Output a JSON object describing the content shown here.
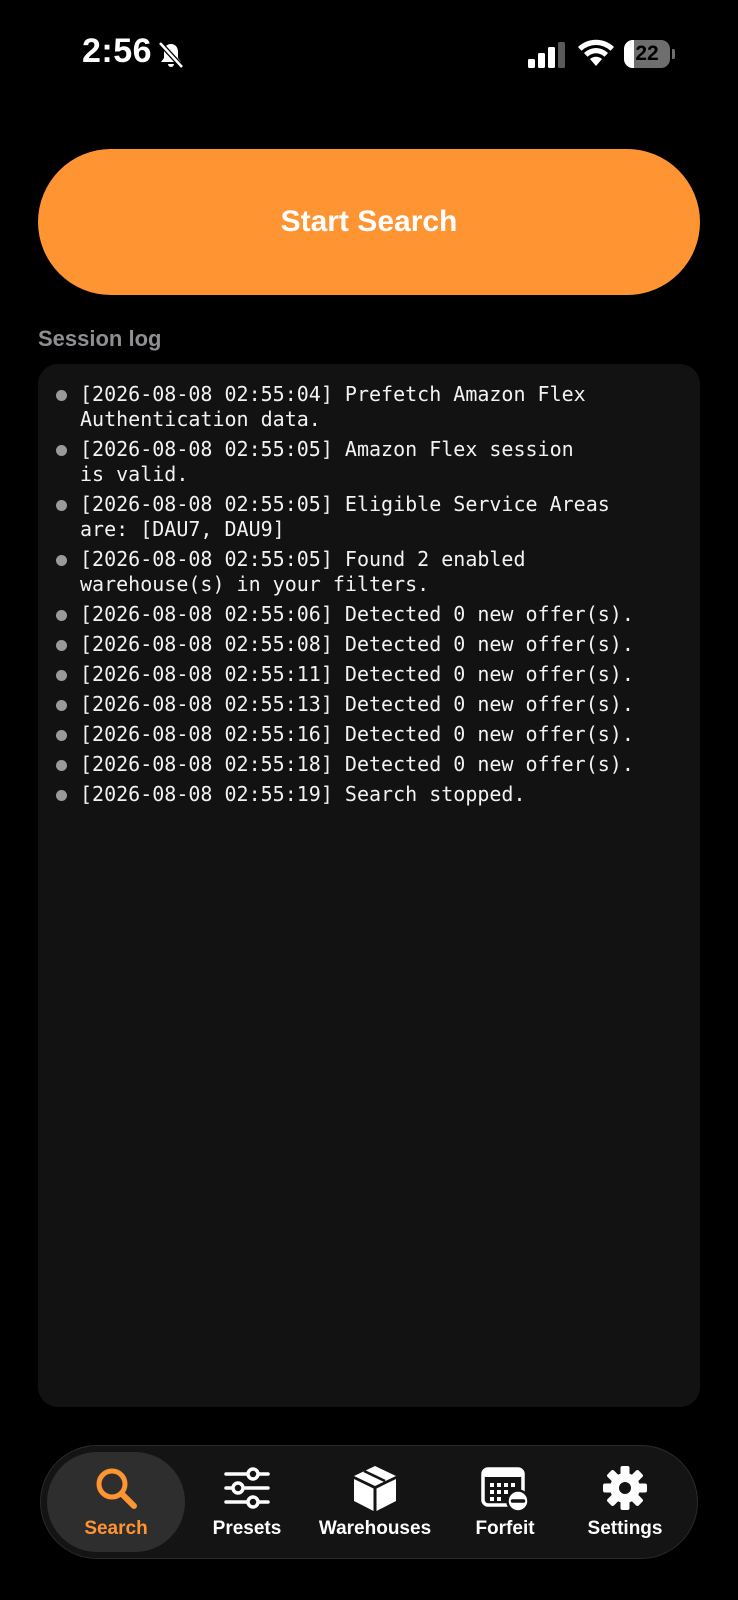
{
  "status_bar": {
    "time": "2:56",
    "battery_percent": "22",
    "battery_level": 0.22
  },
  "start_button": {
    "label": "Start Search"
  },
  "session_log": {
    "title": "Session log",
    "entries": [
      "[2026-08-08 02:55:04] Prefetch Amazon Flex\nAuthentication data.",
      "[2026-08-08 02:55:05] Amazon Flex session\nis valid.",
      "[2026-08-08 02:55:05] Eligible Service Areas\nare: [DAU7, DAU9]",
      "[2026-08-08 02:55:05] Found 2 enabled\nwarehouse(s) in your filters.",
      "[2026-08-08 02:55:06] Detected 0 new offer(s).",
      "[2026-08-08 02:55:08] Detected 0 new offer(s).",
      "[2026-08-08 02:55:11] Detected 0 new offer(s).",
      "[2026-08-08 02:55:13] Detected 0 new offer(s).",
      "[2026-08-08 02:55:16] Detected 0 new offer(s).",
      "[2026-08-08 02:55:18] Detected 0 new offer(s).",
      "[2026-08-08 02:55:19] Search stopped."
    ]
  },
  "tab_bar": {
    "tabs": [
      {
        "label": "Search",
        "icon": "search-icon",
        "active": true
      },
      {
        "label": "Presets",
        "icon": "sliders-icon",
        "active": false
      },
      {
        "label": "Warehouses",
        "icon": "box-icon",
        "active": false
      },
      {
        "label": "Forfeit",
        "icon": "calendar-minus-icon",
        "active": false
      },
      {
        "label": "Settings",
        "icon": "gear-icon",
        "active": false
      }
    ]
  },
  "colors": {
    "accent": "#ff9433",
    "background": "#000000",
    "panel": "#121212"
  }
}
